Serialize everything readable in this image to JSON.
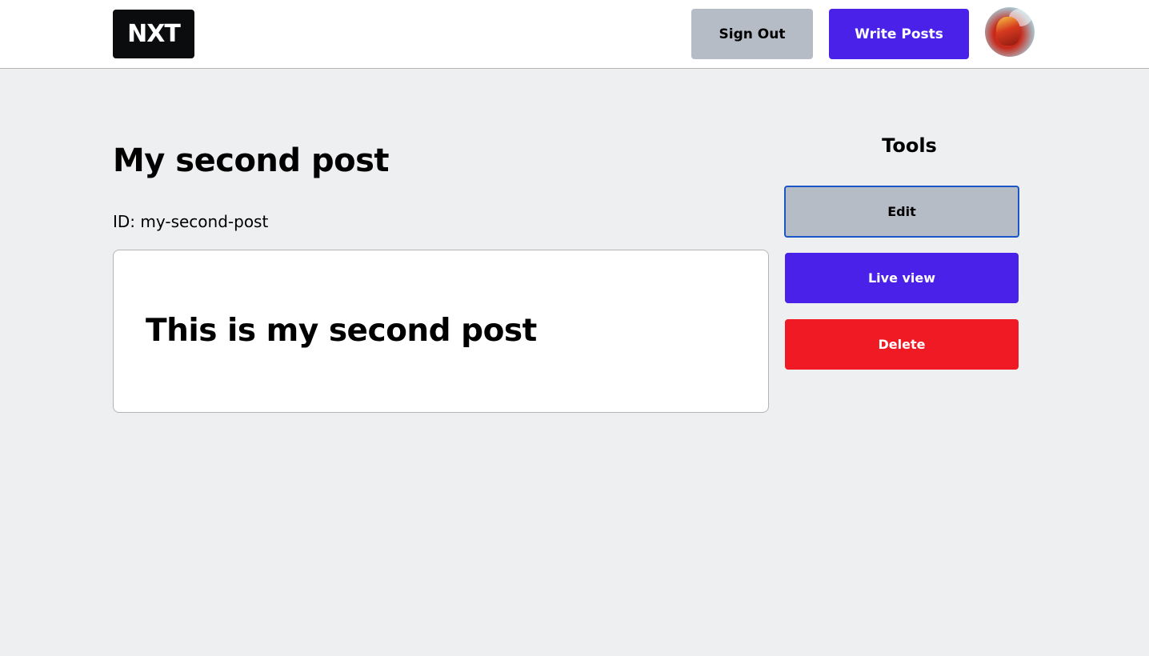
{
  "navbar": {
    "logo_text": "NXT",
    "signout_label": "Sign Out",
    "write_label": "Write Posts",
    "avatar_name": "user-avatar"
  },
  "post": {
    "title": "My second post",
    "id_line": "ID: my-second-post",
    "content_heading": "This is my second post"
  },
  "tools": {
    "title": "Tools",
    "edit_label": "Edit",
    "live_view_label": "Live view",
    "delete_label": "Delete"
  },
  "colors": {
    "primary_blue": "#4a21e8",
    "gray_button": "#b6bcc6",
    "danger_red": "#f01a24",
    "page_background": "#eeeff1"
  }
}
